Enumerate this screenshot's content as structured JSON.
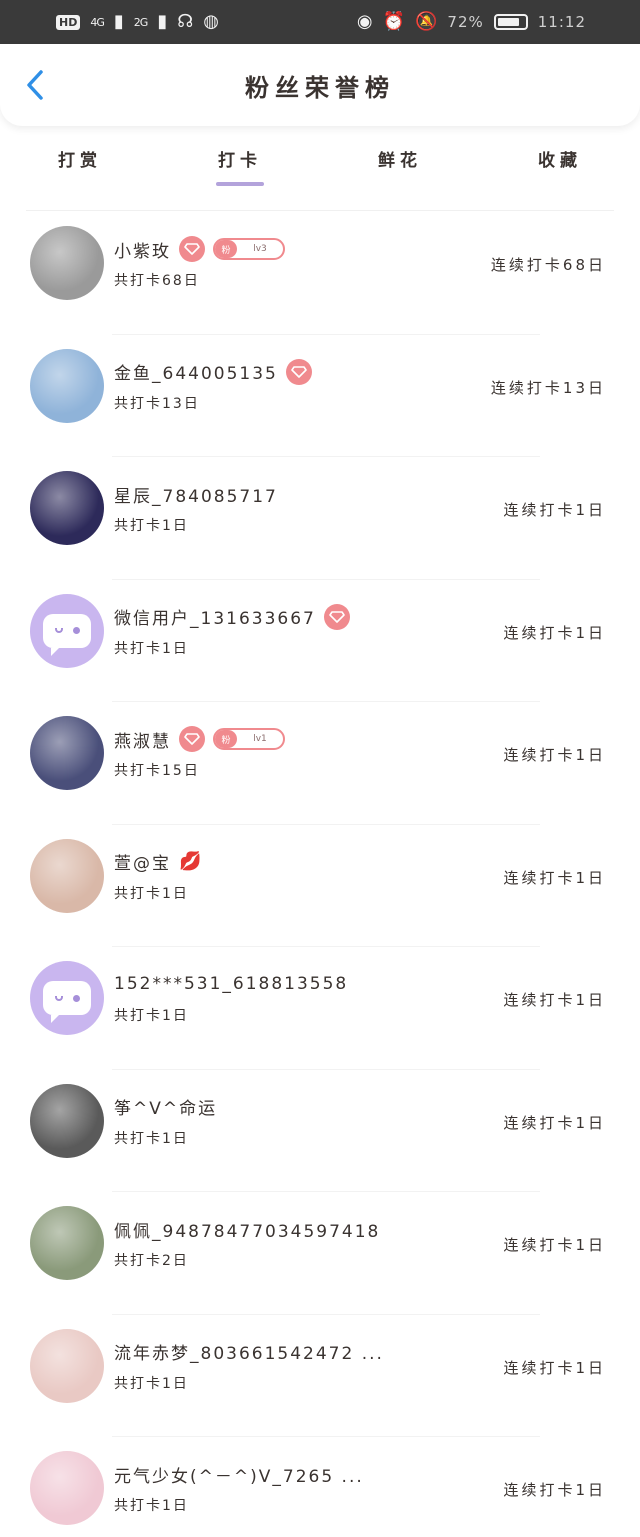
{
  "status_bar": {
    "hd": "HD",
    "sig1": "4G",
    "sig2": "2G",
    "battery_pct": "72%",
    "time": "11:12"
  },
  "header": {
    "title": "粉丝荣誉榜"
  },
  "tabs": [
    {
      "label": "打赏",
      "active": false
    },
    {
      "label": "打卡",
      "active": true
    },
    {
      "label": "鲜花",
      "active": false
    },
    {
      "label": "收藏",
      "active": false
    }
  ],
  "fans": [
    {
      "name": "小紫玫",
      "badge_diamond": true,
      "level_prefix": "粉",
      "level": "lv3",
      "total": "共打卡68日",
      "streak": "连续打卡68日",
      "avatar_color": "#9a9a9a"
    },
    {
      "name": "金鱼_644005135",
      "badge_diamond": true,
      "total": "共打卡13日",
      "streak": "连续打卡13日",
      "avatar_color": "#8fb3d9"
    },
    {
      "name": "星辰_784085717",
      "total": "共打卡1日",
      "streak": "连续打卡1日",
      "avatar_color": "#2d2a5a"
    },
    {
      "name": "微信用户_131633667",
      "badge_diamond": true,
      "total": "共打卡1日",
      "streak": "连续打卡1日",
      "avatar_color": "wx"
    },
    {
      "name": "燕淑慧",
      "badge_diamond": true,
      "level_prefix": "粉",
      "level": "lv1",
      "total": "共打卡15日",
      "streak": "连续打卡1日",
      "avatar_color": "#4a4f7a"
    },
    {
      "name": "萱@宝",
      "lips": true,
      "total": "共打卡1日",
      "streak": "连续打卡1日",
      "avatar_color": "#d9b8a8"
    },
    {
      "name": "152***531_618813558",
      "total": "共打卡1日",
      "streak": "连续打卡1日",
      "avatar_color": "wx"
    },
    {
      "name": "筝^V^命运",
      "total": "共打卡1日",
      "streak": "连续打卡1日",
      "avatar_color": "#5a5a5a"
    },
    {
      "name": "佩佩_9487847703459741​8",
      "total": "共打卡2日",
      "streak": "连续打卡1日",
      "avatar_color": "#8a9a7a"
    },
    {
      "name": "流年赤梦_803661542472 ...",
      "total": "共打卡1日",
      "streak": "连续打卡1日",
      "avatar_color": "#e9c9c4"
    },
    {
      "name": "元气少女(^－^)V_7265 ...",
      "total": "共打卡1日",
      "streak": "连续打卡1日",
      "avatar_color": "#f0c9d4"
    }
  ],
  "colors": {
    "accent_underline": "#b3a3db",
    "diamond_badge": "#f08a8e",
    "back_arrow": "#2f8fe6"
  }
}
